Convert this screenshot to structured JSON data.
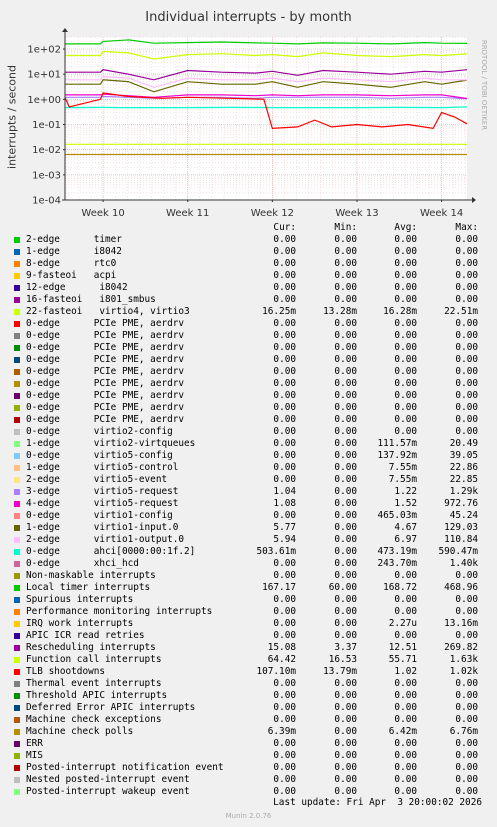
{
  "title": "Individual interrupts - by month",
  "ylabel": "interrupts / second",
  "watermark": "RRDTOOL / TOBI OETIKER",
  "footer": "Munin 2.0.76",
  "last_update": "Last update: Fri Apr  3 20:00:02 2026",
  "columns": {
    "cur": "Cur:",
    "min": "Min:",
    "avg": "Avg:",
    "max": "Max:"
  },
  "legend": [
    {
      "label": "2-edge      timer",
      "color": "#00cc00",
      "cur": "0.00",
      "min": "0.00",
      "avg": "0.00",
      "max": "0.00"
    },
    {
      "label": "1-edge      i8042",
      "color": "#0066b3",
      "cur": "0.00",
      "min": "0.00",
      "avg": "0.00",
      "max": "0.00"
    },
    {
      "label": "8-edge      rtc0",
      "color": "#ff8000",
      "cur": "0.00",
      "min": "0.00",
      "avg": "0.00",
      "max": "0.00"
    },
    {
      "label": "9-fasteoi   acpi",
      "color": "#ffcc00",
      "cur": "0.00",
      "min": "0.00",
      "avg": "0.00",
      "max": "0.00"
    },
    {
      "label": "12-edge      i8042",
      "color": "#330099",
      "cur": "0.00",
      "min": "0.00",
      "avg": "0.00",
      "max": "0.00"
    },
    {
      "label": "16-fasteoi   i801_smbus",
      "color": "#990099",
      "cur": "0.00",
      "min": "0.00",
      "avg": "0.00",
      "max": "0.00"
    },
    {
      "label": "22-fasteoi   virtio4, virtio3",
      "color": "#ccff00",
      "cur": "16.25m",
      "min": "13.28m",
      "avg": "16.28m",
      "max": "22.51m"
    },
    {
      "label": "0-edge      PCIe PME, aerdrv",
      "color": "#ff0000",
      "cur": "0.00",
      "min": "0.00",
      "avg": "0.00",
      "max": "0.00"
    },
    {
      "label": "0-edge      PCIe PME, aerdrv",
      "color": "#808080",
      "cur": "0.00",
      "min": "0.00",
      "avg": "0.00",
      "max": "0.00"
    },
    {
      "label": "0-edge      PCIe PME, aerdrv",
      "color": "#008f00",
      "cur": "0.00",
      "min": "0.00",
      "avg": "0.00",
      "max": "0.00"
    },
    {
      "label": "0-edge      PCIe PME, aerdrv",
      "color": "#00487d",
      "cur": "0.00",
      "min": "0.00",
      "avg": "0.00",
      "max": "0.00"
    },
    {
      "label": "0-edge      PCIe PME, aerdrv",
      "color": "#b35a00",
      "cur": "0.00",
      "min": "0.00",
      "avg": "0.00",
      "max": "0.00"
    },
    {
      "label": "0-edge      PCIe PME, aerdrv",
      "color": "#b38f00",
      "cur": "0.00",
      "min": "0.00",
      "avg": "0.00",
      "max": "0.00"
    },
    {
      "label": "0-edge      PCIe PME, aerdrv",
      "color": "#6b006b",
      "cur": "0.00",
      "min": "0.00",
      "avg": "0.00",
      "max": "0.00"
    },
    {
      "label": "0-edge      PCIe PME, aerdrv",
      "color": "#8fb300",
      "cur": "0.00",
      "min": "0.00",
      "avg": "0.00",
      "max": "0.00"
    },
    {
      "label": "0-edge      PCIe PME, aerdrv",
      "color": "#b30000",
      "cur": "0.00",
      "min": "0.00",
      "avg": "0.00",
      "max": "0.00"
    },
    {
      "label": "0-edge      virtio2-config",
      "color": "#bebebe",
      "cur": "0.00",
      "min": "0.00",
      "avg": "0.00",
      "max": "0.00"
    },
    {
      "label": "1-edge      virtio2-virtqueues",
      "color": "#80ff80",
      "cur": "0.00",
      "min": "0.00",
      "avg": "111.57m",
      "max": "20.49"
    },
    {
      "label": "0-edge      virtio5-config",
      "color": "#80c9ff",
      "cur": "0.00",
      "min": "0.00",
      "avg": "137.92m",
      "max": "39.05"
    },
    {
      "label": "1-edge      virtio5-control",
      "color": "#ffc080",
      "cur": "0.00",
      "min": "0.00",
      "avg": "7.55m",
      "max": "22.86"
    },
    {
      "label": "2-edge      virtio5-event",
      "color": "#ffe680",
      "cur": "0.00",
      "min": "0.00",
      "avg": "7.55m",
      "max": "22.85"
    },
    {
      "label": "3-edge      virtio5-request",
      "color": "#aa80ff",
      "cur": "1.04",
      "min": "0.00",
      "avg": "1.22",
      "max": "1.29k"
    },
    {
      "label": "4-edge      virtio5-request",
      "color": "#ee00cc",
      "cur": "1.08",
      "min": "0.00",
      "avg": "1.52",
      "max": "972.76"
    },
    {
      "label": "0-edge      virtio1-config",
      "color": "#ff8080",
      "cur": "0.00",
      "min": "0.00",
      "avg": "465.03m",
      "max": "45.24"
    },
    {
      "label": "1-edge      virtio1-input.0",
      "color": "#666600",
      "cur": "5.77",
      "min": "0.00",
      "avg": "4.67",
      "max": "129.03"
    },
    {
      "label": "2-edge      virtio1-output.0",
      "color": "#ffbfff",
      "cur": "5.94",
      "min": "0.00",
      "avg": "6.97",
      "max": "110.84"
    },
    {
      "label": "0-edge      ahci[0000:00:1f.2]",
      "color": "#00ffcc",
      "cur": "503.61m",
      "min": "0.00",
      "avg": "473.19m",
      "max": "590.47m"
    },
    {
      "label": "0-edge      xhci_hcd",
      "color": "#cc6699",
      "cur": "0.00",
      "min": "0.00",
      "avg": "243.70m",
      "max": "1.40k"
    },
    {
      "label": "Non-maskable interrupts",
      "color": "#999900",
      "cur": "0.00",
      "min": "0.00",
      "avg": "0.00",
      "max": "0.00"
    },
    {
      "label": "Local timer interrupts",
      "color": "#00cc00",
      "cur": "167.17",
      "min": "60.00",
      "avg": "168.72",
      "max": "468.96"
    },
    {
      "label": "Spurious interrupts",
      "color": "#0066b3",
      "cur": "0.00",
      "min": "0.00",
      "avg": "0.00",
      "max": "0.00"
    },
    {
      "label": "Performance monitoring interrupts",
      "color": "#ff8000",
      "cur": "0.00",
      "min": "0.00",
      "avg": "0.00",
      "max": "0.00"
    },
    {
      "label": "IRQ work interrupts",
      "color": "#ffcc00",
      "cur": "0.00",
      "min": "0.00",
      "avg": "2.27u",
      "max": "13.16m"
    },
    {
      "label": "APIC ICR read retries",
      "color": "#330099",
      "cur": "0.00",
      "min": "0.00",
      "avg": "0.00",
      "max": "0.00"
    },
    {
      "label": "Rescheduling interrupts",
      "color": "#990099",
      "cur": "15.08",
      "min": "3.37",
      "avg": "12.51",
      "max": "269.82"
    },
    {
      "label": "Function call interrupts",
      "color": "#ccff00",
      "cur": "64.42",
      "min": "16.53",
      "avg": "55.71",
      "max": "1.63k"
    },
    {
      "label": "TLB shootdowns",
      "color": "#ff0000",
      "cur": "107.10m",
      "min": "13.79m",
      "avg": "1.02",
      "max": "1.02k"
    },
    {
      "label": "Thermal event interrupts",
      "color": "#808080",
      "cur": "0.00",
      "min": "0.00",
      "avg": "0.00",
      "max": "0.00"
    },
    {
      "label": "Threshold APIC interrupts",
      "color": "#008f00",
      "cur": "0.00",
      "min": "0.00",
      "avg": "0.00",
      "max": "0.00"
    },
    {
      "label": "Deferred Error APIC interrupts",
      "color": "#00487d",
      "cur": "0.00",
      "min": "0.00",
      "avg": "0.00",
      "max": "0.00"
    },
    {
      "label": "Machine check exceptions",
      "color": "#b35a00",
      "cur": "0.00",
      "min": "0.00",
      "avg": "0.00",
      "max": "0.00"
    },
    {
      "label": "Machine check polls",
      "color": "#b38f00",
      "cur": "6.39m",
      "min": "0.00",
      "avg": "6.42m",
      "max": "6.76m"
    },
    {
      "label": "ERR",
      "color": "#6b006b",
      "cur": "0.00",
      "min": "0.00",
      "avg": "0.00",
      "max": "0.00"
    },
    {
      "label": "MIS",
      "color": "#8fb300",
      "cur": "0.00",
      "min": "0.00",
      "avg": "0.00",
      "max": "0.00"
    },
    {
      "label": "Posted-interrupt notification event",
      "color": "#b30000",
      "cur": "0.00",
      "min": "0.00",
      "avg": "0.00",
      "max": "0.00"
    },
    {
      "label": "Nested posted-interrupt event",
      "color": "#bebebe",
      "cur": "0.00",
      "min": "0.00",
      "avg": "0.00",
      "max": "0.00"
    },
    {
      "label": "Posted-interrupt wakeup event",
      "color": "#80ff80",
      "cur": "0.00",
      "min": "0.00",
      "avg": "0.00",
      "max": "0.00"
    }
  ],
  "chart_data": {
    "type": "line",
    "title": "Individual interrupts - by month",
    "ylabel": "interrupts / second",
    "yscale": "log",
    "ylim": [
      0.0001,
      300
    ],
    "grid": true,
    "y_ticks": [
      {
        "value": 100,
        "label": "1e+02"
      },
      {
        "value": 10,
        "label": "1e+01"
      },
      {
        "value": 1,
        "label": "1e+00"
      },
      {
        "value": 0.1,
        "label": "1e-01"
      },
      {
        "value": 0.01,
        "label": "1e-02"
      },
      {
        "value": 0.001,
        "label": "1e-03"
      },
      {
        "value": 0.0001,
        "label": "1e-04"
      }
    ],
    "x_ticks": [
      {
        "week": 10,
        "label": "Week 10"
      },
      {
        "week": 11,
        "label": "Week 11"
      },
      {
        "week": 12,
        "label": "Week 12"
      },
      {
        "week": 13,
        "label": "Week 13"
      },
      {
        "week": 14,
        "label": "Week 14"
      }
    ],
    "xlim": [
      9.55,
      14.3
    ],
    "series": [
      {
        "name": "Local timer interrupts",
        "color": "#00cc00",
        "x": [
          9.55,
          9.97,
          10.0,
          10.3,
          10.6,
          11.0,
          11.4,
          11.8,
          12.0,
          12.3,
          12.6,
          13.0,
          13.4,
          13.8,
          14.0,
          14.3
        ],
        "values": [
          160,
          160,
          200,
          230,
          170,
          180,
          190,
          175,
          170,
          160,
          175,
          170,
          160,
          180,
          170,
          167
        ]
      },
      {
        "name": "Function call interrupts",
        "color": "#ccff00",
        "x": [
          9.55,
          9.97,
          10.0,
          10.3,
          10.6,
          11.0,
          11.4,
          11.8,
          12.0,
          12.3,
          12.6,
          13.0,
          13.4,
          13.8,
          14.0,
          14.3
        ],
        "values": [
          55,
          55,
          80,
          70,
          40,
          60,
          65,
          55,
          60,
          50,
          70,
          55,
          50,
          60,
          55,
          64
        ]
      },
      {
        "name": "Rescheduling interrupts",
        "color": "#990099",
        "x": [
          9.55,
          9.97,
          10.0,
          10.3,
          10.6,
          11.0,
          11.4,
          11.8,
          12.0,
          12.3,
          12.6,
          13.0,
          13.4,
          13.8,
          14.0,
          14.3
        ],
        "values": [
          12,
          12,
          15,
          10,
          6,
          14,
          12,
          11,
          13,
          9,
          14,
          12,
          10,
          13,
          12,
          15
        ]
      },
      {
        "name": "1-edge      virtio1-input.0",
        "color": "#666600",
        "x": [
          9.55,
          9.97,
          10.0,
          10.3,
          10.6,
          11.0,
          11.4,
          11.8,
          12.0,
          12.3,
          12.6,
          13.0,
          13.4,
          13.8,
          14.0,
          14.3
        ],
        "values": [
          4,
          4,
          6,
          5,
          2,
          5,
          4,
          4,
          5,
          3,
          5,
          4,
          3,
          5,
          4,
          5.8
        ]
      },
      {
        "name": "2-edge      virtio1-output.0",
        "color": "#ffbfff",
        "x": [
          9.55,
          9.97,
          10.0,
          10.3,
          10.6,
          11.0,
          11.4,
          11.8,
          12.0,
          12.3,
          12.6,
          13.0,
          13.4,
          13.8,
          14.0,
          14.3
        ],
        "values": [
          6,
          6,
          8,
          7,
          3,
          7,
          6,
          6,
          7,
          5,
          7,
          6,
          5,
          7,
          6,
          5.9
        ]
      },
      {
        "name": "3-edge      virtio5-request",
        "color": "#aa80ff",
        "x": [
          9.55,
          9.97,
          10.0,
          10.3,
          10.6,
          11.0,
          11.4,
          11.8,
          12.0,
          12.3,
          12.6,
          13.0,
          13.4,
          13.8,
          14.0,
          14.3
        ],
        "values": [
          1.2,
          1.2,
          1.3,
          1.2,
          1.1,
          1.2,
          1.2,
          1.1,
          1.2,
          1.2,
          1.2,
          1.2,
          1.1,
          1.2,
          1.2,
          1.04
        ]
      },
      {
        "name": "4-edge      virtio5-request",
        "color": "#ee00cc",
        "x": [
          9.55,
          9.97,
          10.0,
          10.3,
          10.6,
          11.0,
          11.4,
          11.8,
          12.0,
          12.3,
          12.6,
          13.0,
          13.4,
          13.8,
          14.0,
          14.3
        ],
        "values": [
          1.5,
          1.5,
          1.6,
          1.4,
          1.2,
          1.5,
          1.5,
          1.4,
          1.5,
          1.4,
          1.5,
          1.5,
          1.4,
          1.5,
          1.5,
          1.08
        ]
      },
      {
        "name": "0-edge      ahci[0000:00:1f.2]",
        "color": "#00ffcc",
        "x": [
          9.55,
          10.0,
          10.2,
          10.6,
          11.0,
          11.5,
          12.0,
          12.5,
          13.0,
          13.5,
          14.0,
          14.3
        ],
        "values": [
          0.47,
          0.48,
          0.47,
          0.47,
          0.47,
          0.48,
          0.47,
          0.47,
          0.47,
          0.48,
          0.47,
          0.5
        ]
      },
      {
        "name": "TLB shootdowns",
        "color": "#ff0000",
        "x": [
          9.55,
          9.6,
          9.97,
          10.0,
          10.3,
          10.7,
          11.0,
          11.5,
          11.9,
          12.0,
          12.3,
          12.5,
          12.7,
          13.0,
          13.3,
          13.6,
          13.9,
          14.0,
          14.15,
          14.3
        ],
        "values": [
          1.2,
          0.5,
          1.0,
          1.8,
          1.3,
          1.1,
          1.2,
          1.1,
          1.0,
          0.07,
          0.08,
          0.15,
          0.08,
          0.1,
          0.08,
          0.1,
          0.07,
          0.3,
          0.2,
          0.107
        ]
      },
      {
        "name": "22-fasteoi   virtio4, virtio3",
        "color": "#ccff00",
        "x": [
          9.55,
          14.3
        ],
        "values": [
          0.0163,
          0.0163
        ]
      },
      {
        "name": "Machine check polls",
        "color": "#b38f00",
        "x": [
          9.55,
          14.3
        ],
        "values": [
          0.0064,
          0.0064
        ]
      }
    ]
  }
}
